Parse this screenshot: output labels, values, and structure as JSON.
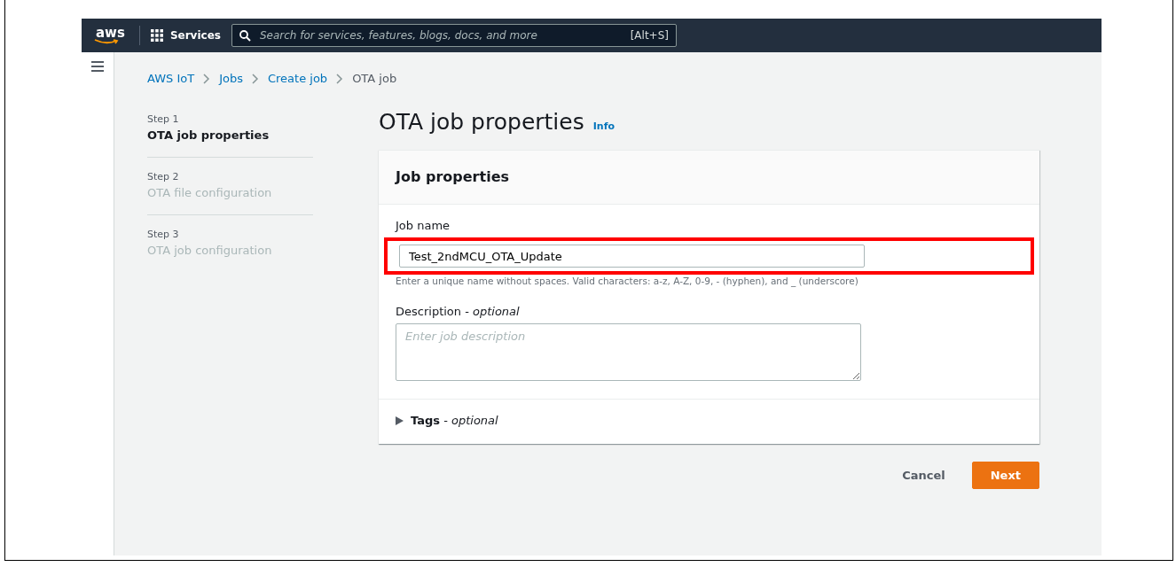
{
  "top_nav": {
    "logo": "aws",
    "services": "Services",
    "search": {
      "placeholder": "Search for services, features, blogs, docs, and more",
      "shortcut": "[Alt+S]"
    }
  },
  "breadcrumb": [
    {
      "label": "AWS IoT",
      "link": true
    },
    {
      "label": "Jobs",
      "link": true
    },
    {
      "label": "Create job",
      "link": true
    },
    {
      "label": "OTA job",
      "link": false
    }
  ],
  "steps": [
    {
      "step": "Step 1",
      "title": "OTA job properties",
      "selected": true
    },
    {
      "step": "Step 2",
      "title": "OTA file configuration",
      "selected": false
    },
    {
      "step": "Step 3",
      "title": "OTA job configuration",
      "selected": false
    }
  ],
  "page_title": "OTA job properties",
  "info_link": "Info",
  "card": {
    "title": "Job properties",
    "job_name": {
      "label": "Job name",
      "value": "Test_2ndMCU_OTA_Update",
      "highlighted": true,
      "hint": "Enter a unique name without spaces. Valid characters: a-z, A-Z, 0-9, - (hyphen), and _ (underscore)"
    },
    "description": {
      "label": "Description - *optional*",
      "placeholder": "Enter job description"
    },
    "tags": {
      "label": "**Tags** - *optional*",
      "expanded": false
    }
  },
  "buttons": [
    {
      "label": "Cancel",
      "kind": "link"
    },
    {
      "label": "Next",
      "kind": "primary"
    }
  ]
}
